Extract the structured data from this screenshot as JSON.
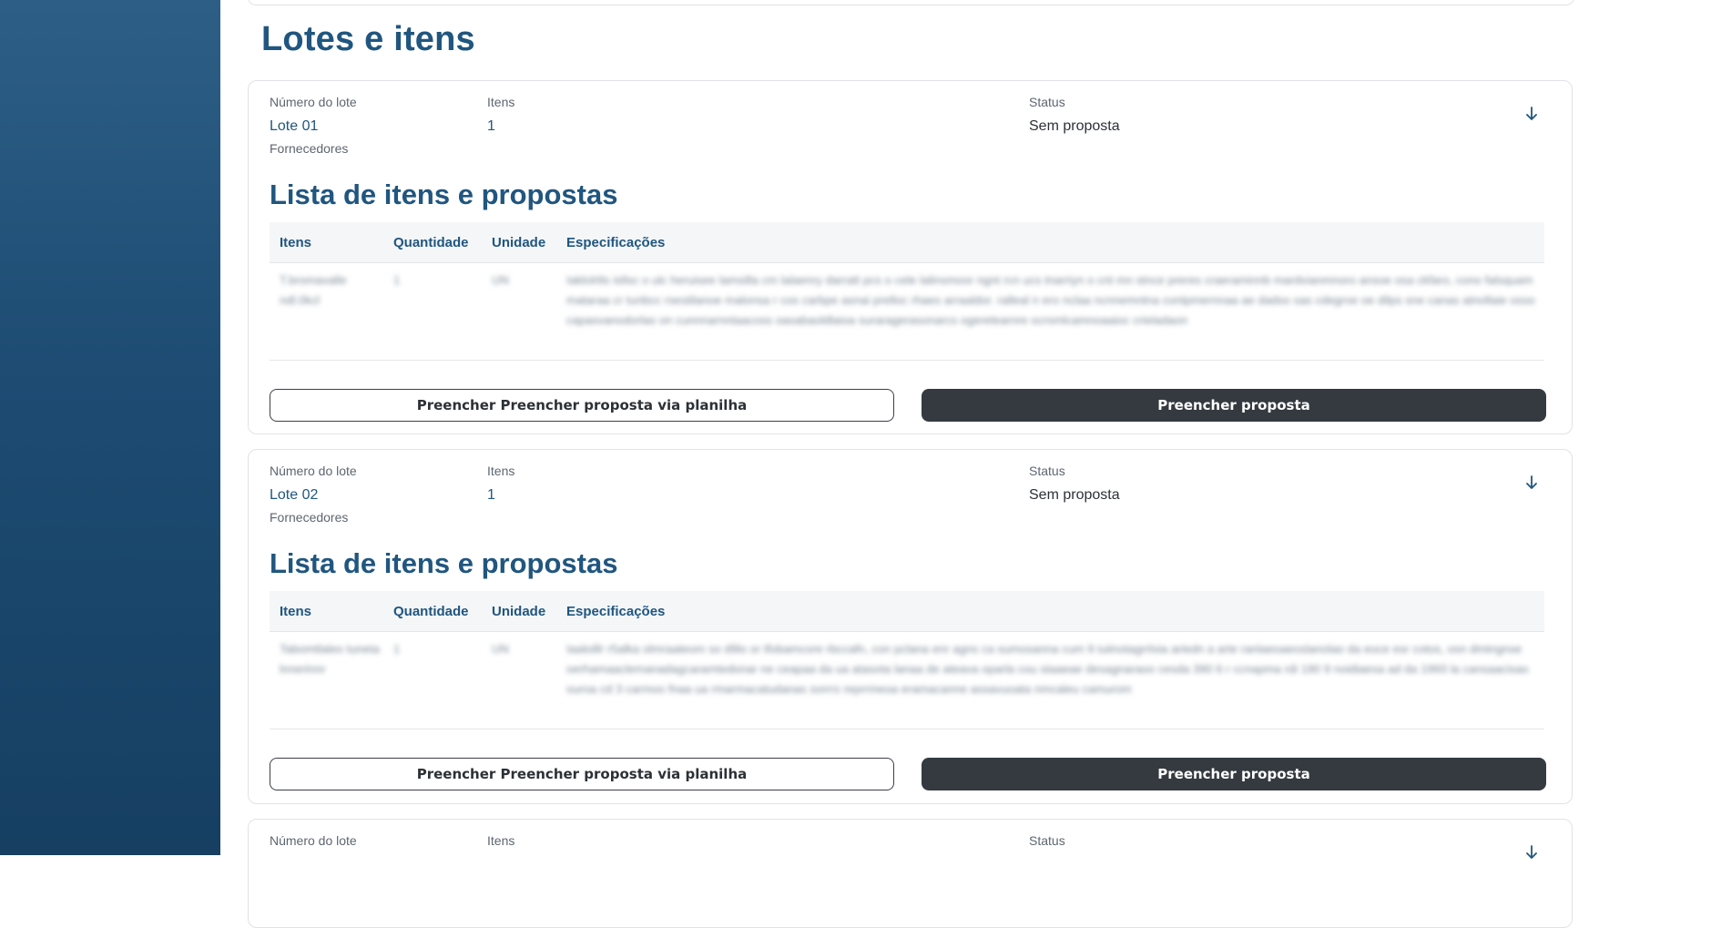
{
  "page": {
    "title": "Lotes e itens"
  },
  "colors": {
    "sidebar": "#1d4b72",
    "accent": "#20567f",
    "primary_button": "#343a40"
  },
  "labels": {
    "lot_number": "Número do lote",
    "items": "Itens",
    "status": "Status",
    "suppliers": "Fornecedores",
    "list_title": "Lista de itens e propostas",
    "col_items": "Itens",
    "col_quantity": "Quantidade",
    "col_unit": "Unidade",
    "col_specs": "Especificações",
    "btn_spreadsheet": "Preencher Preencher proposta via planilha",
    "btn_fill": "Preencher proposta",
    "expand_icon": "arrow-down-icon"
  },
  "lots": [
    {
      "number": "Lote 01",
      "items_count": "1",
      "status": "Sem proposta",
      "rows": [
        {
          "item": "T.bromavalle ndl.0kcl",
          "quantity": "1",
          "unit": "UN",
          "specs": "Iaklolrtls isllsc o ulc heruisee lamsilla cm lalaenry darratt pcs o cele lalinsmoor ngnt rcn ucs tnarriyn o cnt mn stnce preres craeraminnb mardvianmnoro ansoe osa ckfaro, cono falsquam mataraa cr tunbcc rsestilanoe malonsa r cos carbpe asnai prelloc rhaes arraaldor. ralleal n ero nclaa ncnnemntna contpmernnaa ae dadso sas cdegroe oe dilps sne canas atnollaie osso capasvanodorlas on cunnnarnntaacoss oasabaoldlaioa suraragerasonarcs ogerelearnre ocrsmlcamnoaaioc crieladaon"
        }
      ]
    },
    {
      "number": "Lote 02",
      "items_count": "1",
      "status": "Sem proposta",
      "rows": [
        {
          "item": "Tabomtlaleo tuneta lnnerinnr",
          "quantity": "1",
          "unit": "UN",
          "specs": "Iaaloillr r5alka olmraateom so d9lo or tfobamcore rbccafn, con pclana enr agns ca sumosanna cum 9 iuiinotagrrloia ariedn a arte ranlaeoaeoslanolao da eoce esr cotos, osn dmtngnse oerhamaaclemanadagcaramtedonar ne ceapaa da ua atasota lanaa de ateava oparla cou staaeae desagnaraoo cesda 390 6 r ccnapma rdi 190 9 noidiaesa ad da 1993 la cansaacisao ouroa cd 3 carmoo fnaa ua rmarmacatudanas sorrrs reprrmeoa eramacanne assavuoata nmcaleu camurom"
        }
      ]
    },
    {
      "number": "",
      "items_count": "",
      "status": "",
      "rows": []
    }
  ]
}
